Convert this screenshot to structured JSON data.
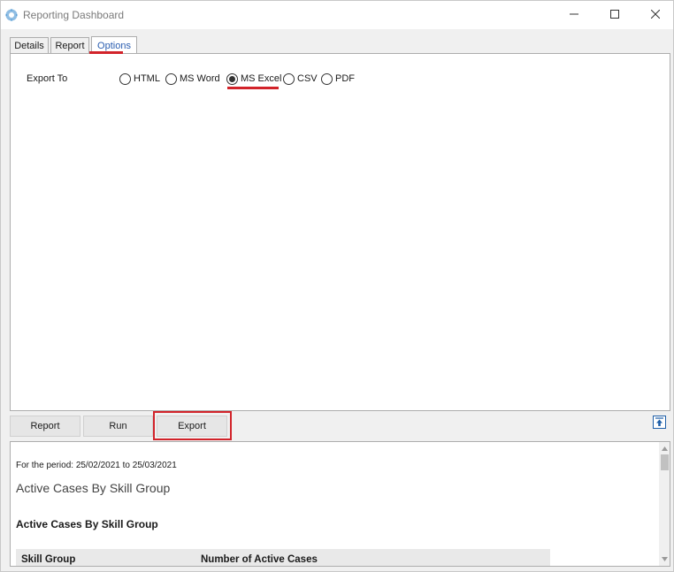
{
  "window": {
    "title": "Reporting Dashboard",
    "icon": "gear-app-icon",
    "controls": {
      "minimize": "minimize-icon",
      "maximize": "maximize-icon",
      "close": "close-icon"
    }
  },
  "tabs": [
    {
      "label": "Details"
    },
    {
      "label": "Report"
    },
    {
      "label": "Options",
      "active": true
    }
  ],
  "options": {
    "export_label": "Export To",
    "formats": [
      {
        "label": "HTML",
        "checked": false
      },
      {
        "label": "MS Word",
        "checked": false
      },
      {
        "label": "MS Excel",
        "checked": true
      },
      {
        "label": "CSV",
        "checked": false
      },
      {
        "label": "PDF",
        "checked": false
      }
    ]
  },
  "buttons": {
    "report": "Report",
    "run": "Run",
    "export": "Export"
  },
  "preview": {
    "period": "For the period: 25/02/2021 to 25/03/2021",
    "title": "Active Cases By Skill Group",
    "section_title": "Active Cases By Skill Group",
    "table_headers": [
      "Skill Group",
      "Number of Active Cases"
    ]
  },
  "colors": {
    "highlight": "#d2232a",
    "active_tab_text": "#2a5db0",
    "accent_icon": "#1f5fa8"
  }
}
